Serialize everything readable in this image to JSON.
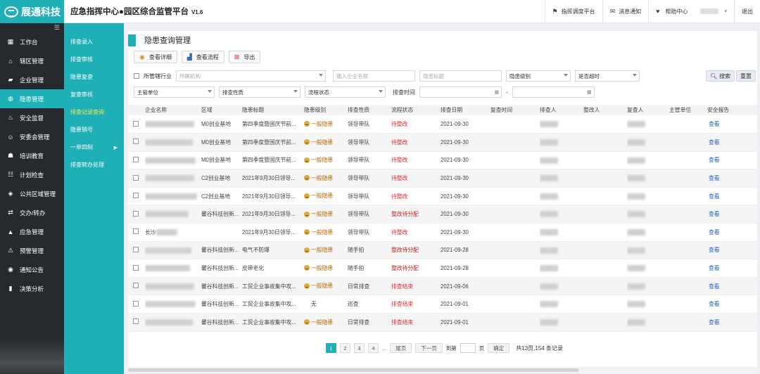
{
  "brand": {
    "name": "展通科技"
  },
  "header": {
    "title": "应急指挥中心●园区综合监管平台",
    "version": "V1.6",
    "links": [
      {
        "label": "指挥调度平台",
        "icon": "flag-icon"
      },
      {
        "label": "消息通知",
        "icon": "chat-icon"
      },
      {
        "label": "帮助中心",
        "icon": "heart-icon"
      }
    ],
    "logout": "退出"
  },
  "sidebar": {
    "items": [
      {
        "label": "工作台",
        "icon": "dashboard-icon"
      },
      {
        "label": "辖区管理",
        "icon": "home-icon"
      },
      {
        "label": "企业管理",
        "icon": "briefcase-icon"
      },
      {
        "label": "隐患管理",
        "icon": "shield-icon",
        "active": true
      },
      {
        "label": "安全监督",
        "icon": "fire-icon"
      },
      {
        "label": "安委会管理",
        "icon": "group-icon"
      },
      {
        "label": "培训教育",
        "icon": "training-icon"
      },
      {
        "label": "计划检查",
        "icon": "checklist-icon"
      },
      {
        "label": "公共区域管理",
        "icon": "cube-icon"
      },
      {
        "label": "交办/转办",
        "icon": "handover-icon"
      },
      {
        "label": "应急管理",
        "icon": "bell-icon"
      },
      {
        "label": "预警管理",
        "icon": "warning-icon"
      },
      {
        "label": "通知公告",
        "icon": "broadcast-icon"
      },
      {
        "label": "决策分析",
        "icon": "bar-chart-icon"
      }
    ]
  },
  "subnav": {
    "items": [
      {
        "label": "排查录入"
      },
      {
        "label": "排查审核"
      },
      {
        "label": "隐患复查"
      },
      {
        "label": "复查审核"
      },
      {
        "label": "排查记录查询",
        "active": true
      },
      {
        "label": "隐患销号"
      },
      {
        "label": "一单四制",
        "has_arrow": true
      },
      {
        "label": "排查转办处理"
      }
    ]
  },
  "panel": {
    "title": "隐患查询管理"
  },
  "toolbar": {
    "view_detail": "查看详细",
    "view_flow": "查看流程",
    "export": "导出"
  },
  "filters": {
    "jurisdiction_label": "所管辖行业",
    "org_placeholder": "所属机构",
    "company_placeholder": "输入企业名称",
    "tag_placeholder": "隐患标题",
    "level_placeholder": "隐患级别",
    "overdue_placeholder": "是否超时",
    "dept_placeholder": "主管单位",
    "nature_placeholder": "排查性质",
    "flow_placeholder": "流程状态",
    "time_label": "排查时间",
    "range_sep": "-",
    "search_button": "搜索",
    "reset_button": "重置"
  },
  "table": {
    "columns": [
      "企业名称",
      "区域",
      "隐患标题",
      "隐患级别",
      "排查性质",
      "流程状态",
      "排查日期",
      "复查时间",
      "排查人",
      "整改人",
      "复查人",
      "主管单位",
      "安全报告"
    ],
    "rows": [
      {
        "area": "M0创业基地",
        "title": "第四季度暨国庆节前...",
        "level": "一般隐患",
        "nature": "领导带队",
        "status": "待整改",
        "status_type": "red",
        "date": "2021-09-30",
        "report": "查看"
      },
      {
        "area": "M0创业基地",
        "title": "第四季度暨国庆节前...",
        "level": "一般隐患",
        "nature": "领导带队",
        "status": "待整改",
        "status_type": "red",
        "date": "2021-09-30",
        "report": "查看"
      },
      {
        "area": "M0创业基地",
        "title": "第四季度暨国庆节前...",
        "level": "一般隐患",
        "nature": "领导带队",
        "status": "待整改",
        "status_type": "red",
        "date": "2021-09-30",
        "report": "查看"
      },
      {
        "area": "C2创业基地",
        "title": "2021年9月30日领导...",
        "level": "一般隐患",
        "nature": "领导带队",
        "status": "待整改",
        "status_type": "red",
        "date": "2021-09-30",
        "report": "查看"
      },
      {
        "area": "C2创业基地",
        "title": "2021年9月30日领导...",
        "level": "一般隐患",
        "nature": "领导带队",
        "status": "待整改",
        "status_type": "red",
        "date": "2021-09-30",
        "report": "查看"
      },
      {
        "area": "馨谷科技创新...",
        "title": "2021年9月30日领导...",
        "level": "一般隐患",
        "nature": "领导带队",
        "status": "整改待分配",
        "status_type": "dred",
        "date": "2021-09-30",
        "report": "查看"
      },
      {
        "company_prefix": "长沙",
        "area": "",
        "title": "2021年9月30日领导...",
        "level": "一般隐患",
        "nature": "领导带队",
        "status": "待整改",
        "status_type": "red",
        "date": "2021-09-30",
        "report": "查看"
      },
      {
        "area": "馨谷科技创新...",
        "title": "电气不防爆",
        "level": "一般隐患",
        "nature": "随手拍",
        "status": "整改待分配",
        "status_type": "dred",
        "date": "2021-09-28",
        "report": "查看"
      },
      {
        "area": "馨谷科技创新...",
        "title": "皮带老化",
        "level": "一般隐患",
        "nature": "随手拍",
        "status": "整改待分配",
        "status_type": "dred",
        "date": "2021-09-28",
        "report": "查看"
      },
      {
        "area": "馨谷科技创新...",
        "title": "工贸企业事故集中攻...",
        "level": "一般隐患",
        "nature": "日常排查",
        "status": "排查结束",
        "status_type": "red",
        "date": "2021-09-06",
        "report": "查看"
      },
      {
        "area": "馨谷科技创新...",
        "title": "工贸企业事故集中攻...",
        "level": "无",
        "nature": "巡查",
        "status": "排查结束",
        "status_type": "red",
        "date": "2021-09-01",
        "report": "查看"
      },
      {
        "area": "馨谷科技创新...",
        "title": "工贸企业事故集中攻...",
        "level": "一般隐患",
        "nature": "日常排查",
        "status": "排查结束",
        "status_type": "red",
        "date": "2021-09-01",
        "report": "查看"
      }
    ]
  },
  "pager": {
    "pages": [
      "1",
      "2",
      "3",
      "4"
    ],
    "current": "1",
    "ellipsis": "...",
    "prev": "尾页",
    "next": "下一页",
    "goto_label": "到第",
    "page_unit": "页",
    "confirm": "确定",
    "summary": "共13页,154 条记录"
  }
}
